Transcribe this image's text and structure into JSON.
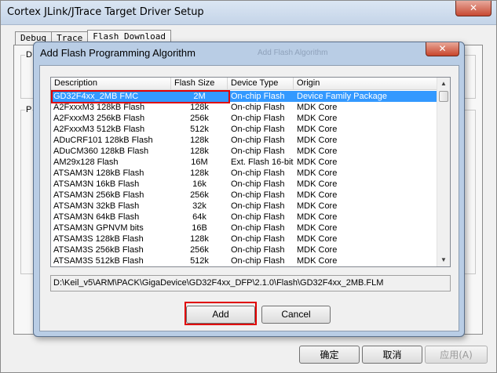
{
  "main_window": {
    "title": "Cortex JLink/JTrace Target Driver Setup",
    "close_glyph": "✕",
    "tabs": [
      {
        "label": "Debug",
        "active": false
      },
      {
        "label": "Trace",
        "active": false
      },
      {
        "label": "Flash Download",
        "active": true
      }
    ],
    "group_labels": [
      "D",
      "P"
    ],
    "buttons": {
      "ok": "确定",
      "cancel": "取消",
      "apply": "应用(A)"
    }
  },
  "dialog": {
    "title": "Add Flash Programming Algorithm",
    "title_ghost": "Add Flash Algorithm",
    "close_glyph": "✕",
    "columns": [
      "Description",
      "Flash Size",
      "Device Type",
      "Origin"
    ],
    "rows": [
      {
        "description": "GD32F4xx_2MB FMC",
        "size": "2M",
        "type": "On-chip Flash",
        "origin": "Device Family Package",
        "selected": true
      },
      {
        "description": "A2FxxxM3 128kB Flash",
        "size": "128k",
        "type": "On-chip Flash",
        "origin": "MDK Core"
      },
      {
        "description": "A2FxxxM3 256kB Flash",
        "size": "256k",
        "type": "On-chip Flash",
        "origin": "MDK Core"
      },
      {
        "description": "A2FxxxM3 512kB Flash",
        "size": "512k",
        "type": "On-chip Flash",
        "origin": "MDK Core"
      },
      {
        "description": "ADuCRF101 128kB Flash",
        "size": "128k",
        "type": "On-chip Flash",
        "origin": "MDK Core"
      },
      {
        "description": "ADuCM360 128kB Flash",
        "size": "128k",
        "type": "On-chip Flash",
        "origin": "MDK Core"
      },
      {
        "description": "AM29x128 Flash",
        "size": "16M",
        "type": "Ext. Flash 16-bit",
        "origin": "MDK Core"
      },
      {
        "description": "ATSAM3N 128kB Flash",
        "size": "128k",
        "type": "On-chip Flash",
        "origin": "MDK Core"
      },
      {
        "description": "ATSAM3N 16kB Flash",
        "size": "16k",
        "type": "On-chip Flash",
        "origin": "MDK Core"
      },
      {
        "description": "ATSAM3N 256kB Flash",
        "size": "256k",
        "type": "On-chip Flash",
        "origin": "MDK Core"
      },
      {
        "description": "ATSAM3N 32kB Flash",
        "size": "32k",
        "type": "On-chip Flash",
        "origin": "MDK Core"
      },
      {
        "description": "ATSAM3N 64kB Flash",
        "size": "64k",
        "type": "On-chip Flash",
        "origin": "MDK Core"
      },
      {
        "description": "ATSAM3N GPNVM bits",
        "size": "16B",
        "type": "On-chip Flash",
        "origin": "MDK Core"
      },
      {
        "description": "ATSAM3S 128kB Flash",
        "size": "128k",
        "type": "On-chip Flash",
        "origin": "MDK Core"
      },
      {
        "description": "ATSAM3S 256kB Flash",
        "size": "256k",
        "type": "On-chip Flash",
        "origin": "MDK Core"
      },
      {
        "description": "ATSAM3S 512kB Flash",
        "size": "512k",
        "type": "On-chip Flash",
        "origin": "MDK Core"
      }
    ],
    "path": "D:\\Keil_v5\\ARM\\PACK\\GigaDevice\\GD32F4xx_DFP\\2.1.0\\Flash\\GD32F4xx_2MB.FLM",
    "buttons": {
      "add": "Add",
      "cancel": "Cancel"
    },
    "highlight_color": "#e00000",
    "selection_color": "#3399ff"
  }
}
